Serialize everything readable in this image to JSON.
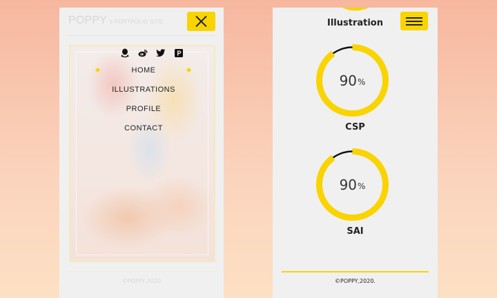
{
  "left_screen": {
    "site_title": "POPPY",
    "site_subtitle": "'s PORTFOLIO SITE",
    "social_icons": [
      "qq-icon",
      "weibo-icon",
      "twitter-icon",
      "pixiv-icon"
    ],
    "nav_items": [
      "HOME",
      "ILLUSTRATIONS",
      "PROFILE",
      "CONTACT"
    ],
    "footer": "©POPPY,2020"
  },
  "right_screen": {
    "section_title": "Illustration",
    "skills": [
      {
        "name": "CSP",
        "percent": 90,
        "display": "90",
        "unit": "%"
      },
      {
        "name": "SAI",
        "percent": 90,
        "display": "90",
        "unit": "%"
      }
    ],
    "footer": "©POPPY,2020."
  },
  "colors": {
    "accent": "#f9d400",
    "gauge_remainder": "#111111",
    "panel_bg": "#f0f0f0",
    "background_top": "#f7b79f",
    "background_bottom": "#fde0c4"
  }
}
